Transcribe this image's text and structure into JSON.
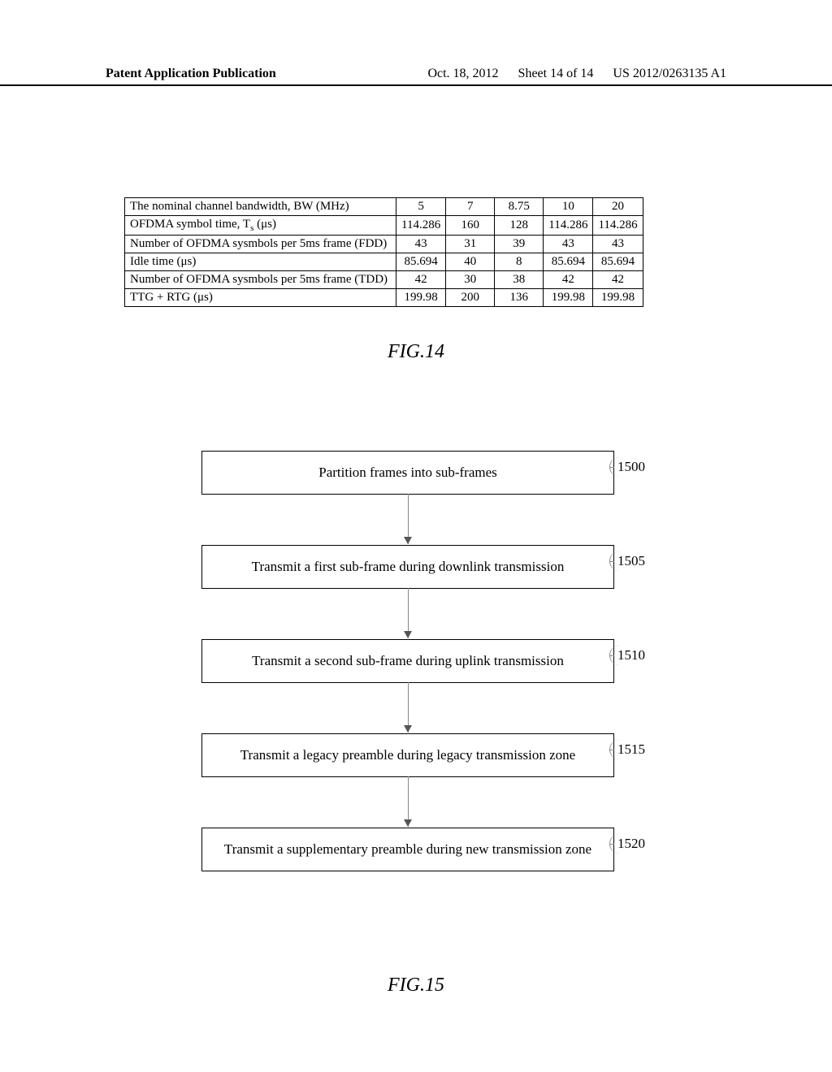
{
  "header": {
    "left": "Patent Application Publication",
    "date": "Oct. 18, 2012",
    "sheet": "Sheet 14 of 14",
    "docnum": "US 2012/0263135 A1"
  },
  "table": {
    "rows": [
      {
        "label": "The nominal channel bandwidth, BW (MHz)",
        "v": [
          "5",
          "7",
          "8.75",
          "10",
          "20"
        ]
      },
      {
        "label": "OFDMA symbol time, T",
        "sub": "s",
        "suffix": " (μs)",
        "v": [
          "114.286",
          "160",
          "128",
          "114.286",
          "114.286"
        ]
      },
      {
        "label": "Number of OFDMA sysmbols per 5ms frame (FDD)",
        "v": [
          "43",
          "31",
          "39",
          "43",
          "43"
        ]
      },
      {
        "label": "Idle time (μs)",
        "v": [
          "85.694",
          "40",
          "8",
          "85.694",
          "85.694"
        ]
      },
      {
        "label": "Number of OFDMA sysmbols per 5ms frame (TDD)",
        "v": [
          "42",
          "30",
          "38",
          "42",
          "42"
        ]
      },
      {
        "label": "TTG + RTG (μs)",
        "v": [
          "199.98",
          "200",
          "136",
          "199.98",
          "199.98"
        ]
      }
    ]
  },
  "fig14": "FIG.14",
  "fig15": "FIG.15",
  "flow": {
    "steps": [
      {
        "text": "Partition frames into sub-frames",
        "num": "1500"
      },
      {
        "text": "Transmit a first sub-frame during downlink transmission",
        "num": "1505"
      },
      {
        "text": "Transmit a second sub-frame during uplink transmission",
        "num": "1510"
      },
      {
        "text": "Transmit a legacy preamble during legacy transmission zone",
        "num": "1515"
      },
      {
        "text": "Transmit a supplementary preamble during new transmission zone",
        "num": "1520"
      }
    ]
  },
  "chart_data": {
    "type": "table",
    "title": "OFDMA frame parameters by channel bandwidth",
    "columns": [
      "5",
      "7",
      "8.75",
      "10",
      "20"
    ],
    "rows": [
      {
        "parameter": "The nominal channel bandwidth, BW (MHz)",
        "values": [
          5,
          7,
          8.75,
          10,
          20
        ]
      },
      {
        "parameter": "OFDMA symbol time, Ts (μs)",
        "values": [
          114.286,
          160,
          128,
          114.286,
          114.286
        ]
      },
      {
        "parameter": "Number of OFDMA symbols per 5ms frame (FDD)",
        "values": [
          43,
          31,
          39,
          43,
          43
        ]
      },
      {
        "parameter": "Idle time (μs)",
        "values": [
          85.694,
          40,
          8,
          85.694,
          85.694
        ]
      },
      {
        "parameter": "Number of OFDMA symbols per 5ms frame (TDD)",
        "values": [
          42,
          30,
          38,
          42,
          42
        ]
      },
      {
        "parameter": "TTG + RTG (μs)",
        "values": [
          199.98,
          200,
          136,
          199.98,
          199.98
        ]
      }
    ]
  }
}
